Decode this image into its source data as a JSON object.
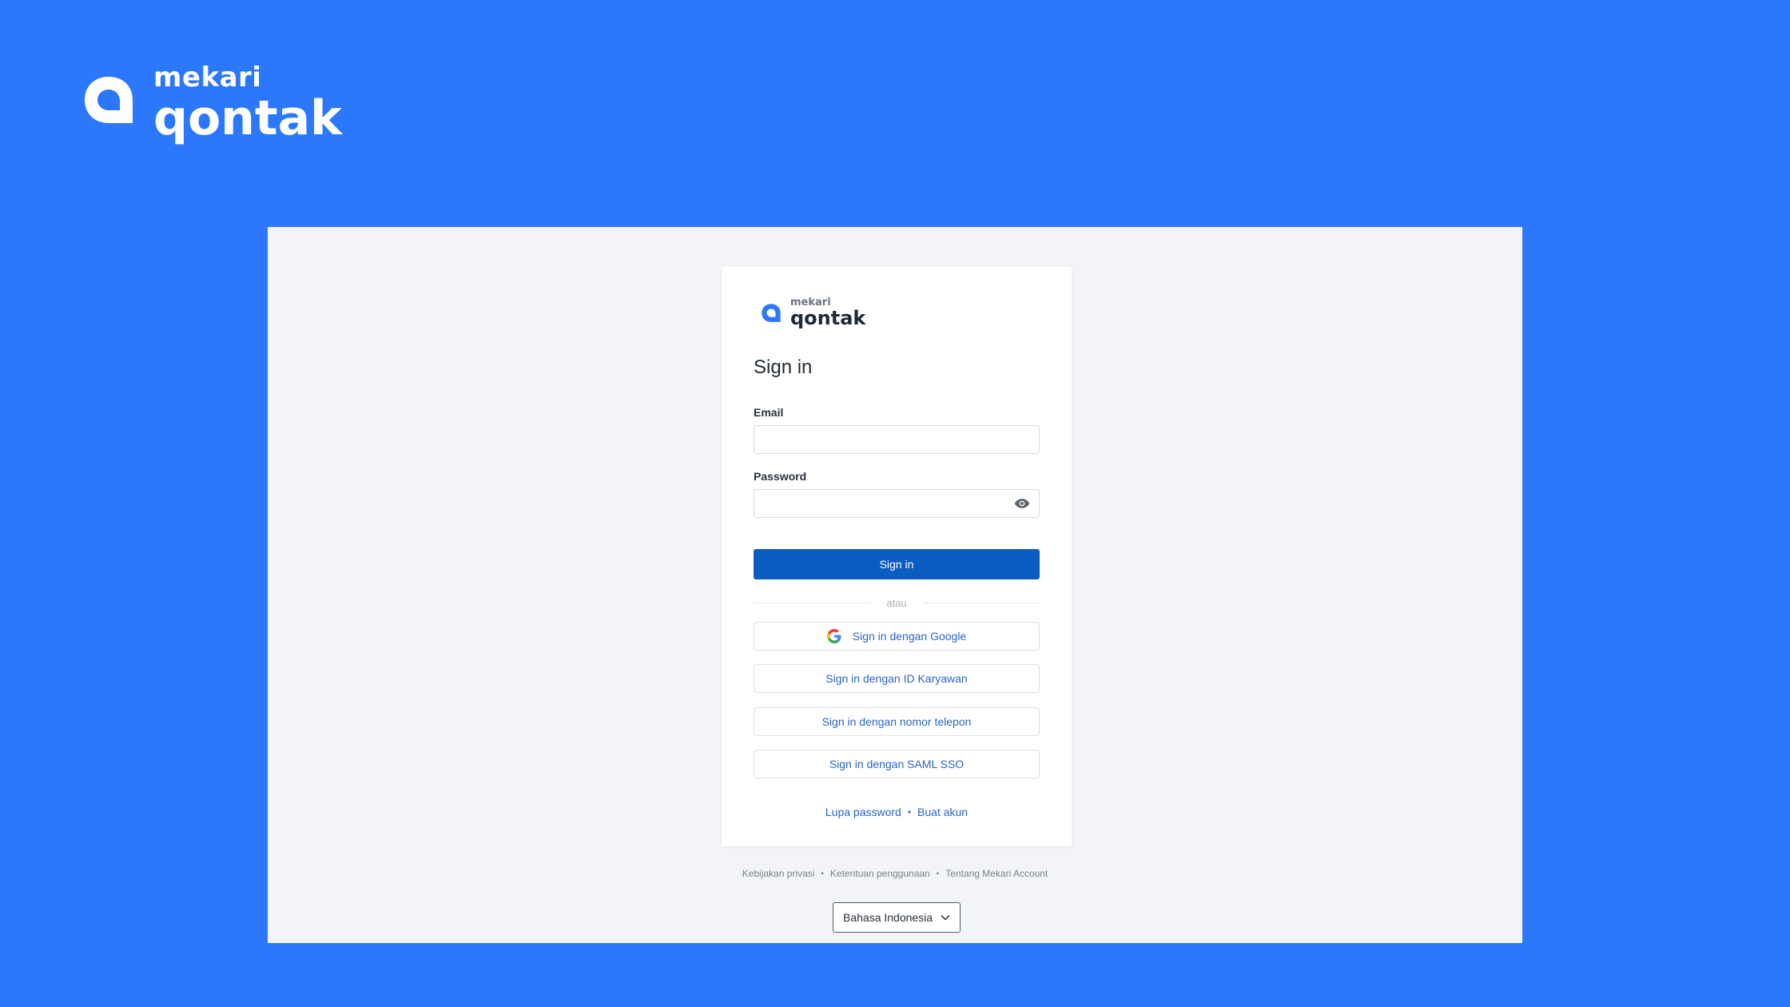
{
  "brand": {
    "small": "mekari",
    "big": "qontak",
    "color": "#2b78fc"
  },
  "card": {
    "logo_small": "mekari",
    "logo_big": "qontak",
    "title": "Sign in",
    "email_label": "Email",
    "email_value": "",
    "password_label": "Password",
    "password_value": "",
    "signin_label": "Sign in",
    "divider_text": "atau",
    "alt_buttons": {
      "google": "Sign in dengan Google",
      "karyawan": "Sign in dengan ID Karyawan",
      "telepon": "Sign in dengan nomor telepon",
      "saml": "Sign in dengan SAML SSO"
    },
    "links": {
      "forgot": "Lupa password",
      "separator": "•",
      "create": "Buat akun"
    }
  },
  "footer": {
    "privacy": "Kebijakan privasi",
    "terms": "Ketentuan penggunaan",
    "about": "Tentang Mekari Account",
    "dot": "•",
    "language": "Bahasa Indonesia"
  },
  "icons": {
    "brand": "qontak-logo-icon",
    "eye": "eye-icon",
    "google": "google-icon",
    "chevron": "chevron-down-icon"
  },
  "colors": {
    "primary_button": "#0b5cc1",
    "link": "#2a64c9",
    "stage": "#f3f4f7"
  }
}
